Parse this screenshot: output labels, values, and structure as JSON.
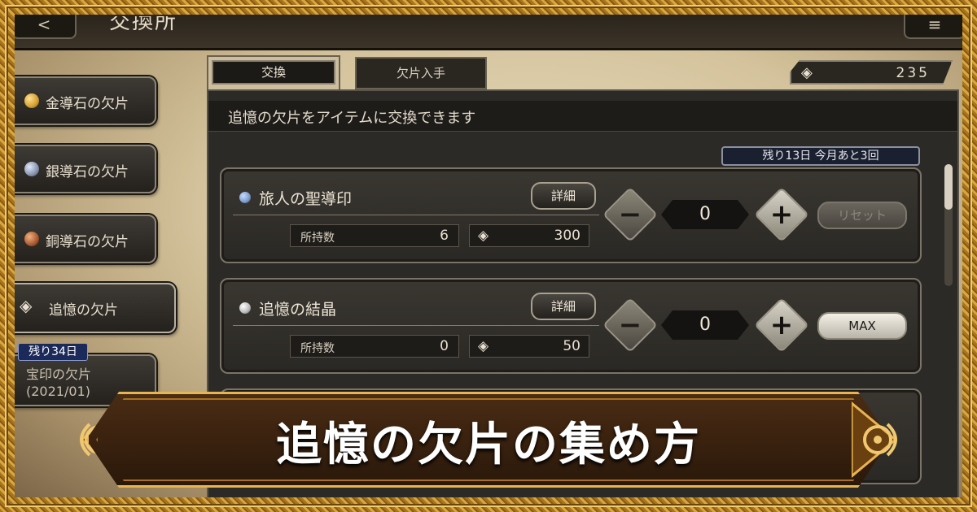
{
  "header": {
    "back_glyph": "<",
    "title": "交換所",
    "menu_glyph": "≡"
  },
  "sidebar": {
    "items": [
      {
        "label": "金導石の欠片",
        "gem_color": "#d4a030"
      },
      {
        "label": "銀導石の欠片",
        "gem_color": "#8894b0"
      },
      {
        "label": "銅導石の欠片",
        "gem_color": "#a85a30"
      },
      {
        "label": "追憶の欠片",
        "icon": "◈",
        "selected": true
      },
      {
        "badge": "残り34日",
        "label_line1": "宝印の欠片",
        "label_line2": "(2021/01)"
      }
    ]
  },
  "tabs": [
    {
      "label": "交換",
      "active": true
    },
    {
      "label": "欠片入手",
      "active": false
    }
  ],
  "currency": {
    "icon": "◈",
    "value": "235"
  },
  "panel": {
    "description": "追憶の欠片をアイテムに交換できます"
  },
  "limit_badge": "残り13日 今月あと3回",
  "items": [
    {
      "name": "旅人の聖導印",
      "icon_color": "#7a9ac8",
      "detail_label": "詳細",
      "owned_label": "所持数",
      "owned": "6",
      "cost_icon": "◈",
      "cost": "300",
      "quantity": "0",
      "minus": "−",
      "plus": "+",
      "side_button": "リセット"
    },
    {
      "name": "追憶の結晶",
      "icon_color": "#b8b8b8",
      "detail_label": "詳細",
      "owned_label": "所持数",
      "owned": "0",
      "cost_icon": "◈",
      "cost": "50",
      "quantity": "0",
      "minus": "−",
      "plus": "+",
      "side_button": "MAX"
    }
  ],
  "banner": {
    "title": "追憶の欠片の集め方"
  },
  "colors": {
    "gold": "#e8b450",
    "banner_bg": "#3a2210",
    "panel_bg": "#2c2a26"
  }
}
